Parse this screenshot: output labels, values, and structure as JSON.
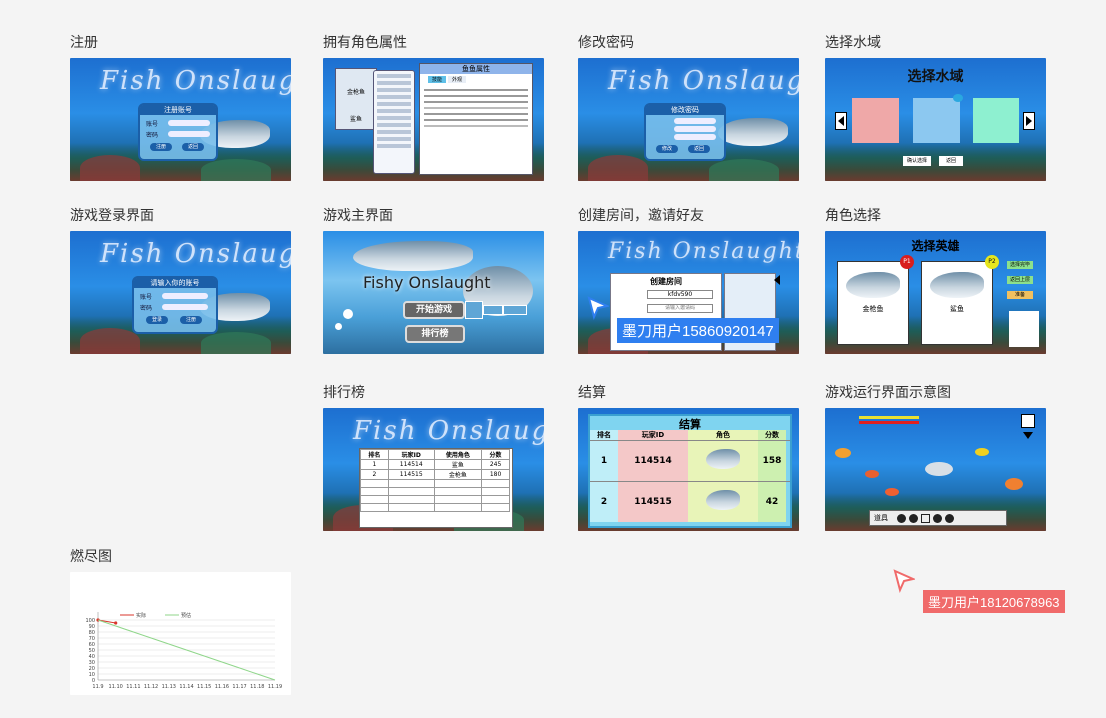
{
  "cards": {
    "register": {
      "title": "注册",
      "logo": "Fish Onslaught",
      "panel_title": "注册账号",
      "field1": "账号",
      "field2": "密码",
      "btn1": "注册",
      "btn2": "返回"
    },
    "role_attr": {
      "title": "拥有角色属性",
      "panel_title": "鱼鱼属性",
      "tab1": "技能",
      "tab2": "外观",
      "list_item1": "金枪鱼",
      "list_item2": "鲨鱼"
    },
    "change_pwd": {
      "title": "修改密码",
      "logo": "Fish Onslaught",
      "panel_title": "修改密码",
      "btn1": "修改",
      "btn2": "返回"
    },
    "select_water": {
      "title": "选择水域",
      "heading": "选择水域",
      "btn1": "确认选择",
      "btn2": "返回"
    },
    "login": {
      "title": "游戏登录界面",
      "logo": "Fish Onslaught",
      "panel_title": "请输入你的账号",
      "field1": "账号",
      "field2": "密码",
      "btn1": "登录",
      "btn2": "注册"
    },
    "main_menu": {
      "title": "游戏主界面",
      "logo": "Fishy Onslaught",
      "btn_start": "开始游戏",
      "btn_rank": "排行榜"
    },
    "create_room": {
      "title": "创建房间，邀请好友",
      "panel_title": "创建房间",
      "room_code": "kfdv590",
      "invite_placeholder": "请输入邀请码"
    },
    "hero_select": {
      "title": "角色选择",
      "heading": "选择英雄",
      "hero1": "金枪鱼",
      "hero2": "鲨鱼",
      "badge1": "P1",
      "badge2": "P2",
      "side1": "选择完毕",
      "side2": "返回上层",
      "side3": "准备"
    },
    "leaderboard": {
      "title": "排行榜",
      "logo": "Fish Onslaught",
      "columns": [
        "排名",
        "玩家ID",
        "使用角色",
        "分数"
      ],
      "rows": [
        [
          "1",
          "114514",
          "鲨鱼",
          "245"
        ],
        [
          "2",
          "114515",
          "金枪鱼",
          "180"
        ]
      ]
    },
    "settlement": {
      "title": "结算",
      "heading": "结算",
      "columns": [
        "排名",
        "玩家ID",
        "角色",
        "分数"
      ],
      "rows": [
        [
          "1",
          "114514",
          "158"
        ],
        [
          "2",
          "114515",
          "42"
        ]
      ]
    },
    "gameplay": {
      "title": "游戏运行界面示意图",
      "toolbar_label": "道具"
    },
    "burndown": {
      "title": "燃尽图"
    }
  },
  "collab": {
    "user1": {
      "label": "墨刀用户15860920147",
      "color": "#2f7ff0"
    },
    "user2": {
      "label": "墨刀用户18120678963",
      "color": "#f06a6a"
    }
  },
  "chart_data": {
    "type": "line",
    "title": "",
    "legend": [
      "实际",
      "预估"
    ],
    "categories": [
      "11.9",
      "11.10",
      "11.11",
      "11.12",
      "11.13",
      "11.14",
      "11.15",
      "11.16",
      "11.17",
      "11.18",
      "11.19"
    ],
    "series": [
      {
        "name": "实际",
        "color": "#d9352b",
        "values": [
          100,
          95
        ]
      },
      {
        "name": "预估",
        "color": "#8fd68a",
        "values": [
          100,
          90,
          80,
          70,
          60,
          50,
          40,
          30,
          20,
          10,
          0
        ]
      }
    ],
    "yticks": [
      0,
      10,
      20,
      30,
      40,
      50,
      60,
      70,
      80,
      90,
      100
    ],
    "ylim": [
      0,
      100
    ]
  }
}
